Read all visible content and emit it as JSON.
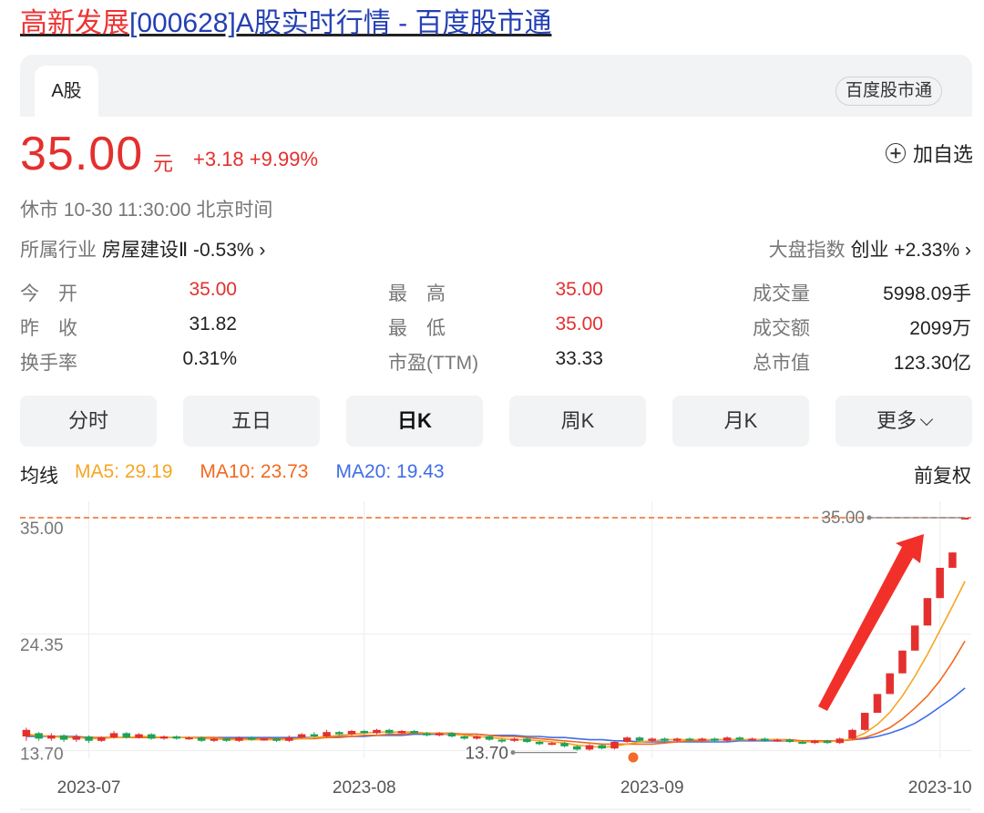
{
  "page_title": {
    "highlight": "高新发展",
    "rest": "[000628]A股实时行情 - 百度股市通"
  },
  "tabs": {
    "a_share": "A股",
    "brand": "百度股市通"
  },
  "quote": {
    "price": "35.00",
    "unit": "元",
    "change": "+3.18 +9.99%",
    "add_watchlist": "加自选",
    "status": "休市  10-30 11:30:00  北京时间",
    "industry_label": "所属行业",
    "industry_value": "房屋建设Ⅱ -0.53% ›",
    "index_label": "大盘指数",
    "index_value": "创业 +2.33% ›"
  },
  "stats": {
    "open_label": "今　开",
    "open": "35.00",
    "high_label": "最　高",
    "high": "35.00",
    "volume_label": "成交量",
    "volume": "5998.09手",
    "prev_label": "昨　收",
    "prev": "31.82",
    "low_label": "最　低",
    "low": "35.00",
    "amount_label": "成交额",
    "amount": "2099万",
    "turnover_label": "换手率",
    "turnover": "0.31%",
    "pe_label": "市盈(TTM)",
    "pe": "33.33",
    "mktcap_label": "总市值",
    "mktcap": "123.30亿"
  },
  "periods": [
    "分时",
    "五日",
    "日K",
    "周K",
    "月K",
    "更多"
  ],
  "active_period": "日K",
  "ma": {
    "label": "均线",
    "ma5": "MA5: 29.19",
    "ma10": "MA10: 23.73",
    "ma20": "MA20: 19.43",
    "adjust": "前复权"
  },
  "colors": {
    "up": "#e3302f",
    "down": "#1ea35a",
    "ma5": "#f5a623",
    "ma10": "#f2691e",
    "ma20": "#3f6de8",
    "link": "#2440b3"
  },
  "chart_data": {
    "type": "candlestick",
    "ylim": [
      13.0,
      36.5
    ],
    "y_ticks": [
      "35.00",
      "24.35",
      "13.70"
    ],
    "x_ticks": [
      "2023-07",
      "2023-08",
      "2023-09",
      "2023-10"
    ],
    "x_tick_index": [
      5,
      27,
      50,
      73
    ],
    "max_label": "35.00",
    "min_label": "13.70",
    "last_close": 35.0,
    "candles": [
      [
        15.0,
        15.6,
        14.6,
        15.8,
        "u"
      ],
      [
        15.3,
        14.8,
        14.6,
        15.4,
        "d"
      ],
      [
        14.8,
        15.1,
        14.6,
        15.3,
        "u"
      ],
      [
        15.1,
        14.7,
        14.5,
        15.2,
        "d"
      ],
      [
        14.7,
        15.0,
        14.5,
        15.2,
        "u"
      ],
      [
        15.0,
        14.6,
        14.4,
        15.1,
        "d"
      ],
      [
        14.6,
        14.9,
        14.5,
        15.0,
        "u"
      ],
      [
        14.9,
        15.3,
        14.8,
        15.5,
        "u"
      ],
      [
        15.3,
        14.9,
        14.8,
        15.4,
        "d"
      ],
      [
        14.9,
        15.2,
        14.8,
        15.3,
        "u"
      ],
      [
        15.2,
        14.8,
        14.7,
        15.3,
        "d"
      ],
      [
        14.8,
        15.0,
        14.7,
        15.1,
        "u"
      ],
      [
        15.0,
        14.8,
        14.7,
        15.1,
        "d"
      ],
      [
        14.8,
        14.9,
        14.7,
        15.0,
        "u"
      ],
      [
        14.9,
        14.6,
        14.5,
        15.0,
        "d"
      ],
      [
        14.6,
        14.8,
        14.5,
        14.9,
        "u"
      ],
      [
        14.8,
        14.6,
        14.5,
        14.9,
        "d"
      ],
      [
        14.6,
        14.9,
        14.5,
        15.0,
        "u"
      ],
      [
        14.9,
        14.7,
        14.6,
        15.0,
        "d"
      ],
      [
        14.7,
        14.8,
        14.6,
        14.9,
        "u"
      ],
      [
        14.8,
        14.6,
        14.5,
        14.9,
        "d"
      ],
      [
        14.6,
        14.9,
        14.5,
        15.1,
        "u"
      ],
      [
        14.9,
        15.2,
        14.8,
        15.3,
        "u"
      ],
      [
        15.2,
        15.0,
        14.9,
        15.4,
        "d"
      ],
      [
        15.0,
        15.4,
        14.9,
        15.6,
        "u"
      ],
      [
        15.4,
        15.2,
        15.1,
        15.5,
        "d"
      ],
      [
        15.2,
        15.5,
        15.1,
        15.6,
        "u"
      ],
      [
        15.5,
        15.3,
        15.2,
        15.6,
        "d"
      ],
      [
        15.3,
        15.6,
        15.2,
        15.7,
        "u"
      ],
      [
        15.6,
        15.3,
        15.2,
        15.7,
        "d"
      ],
      [
        15.3,
        15.5,
        15.2,
        15.6,
        "u"
      ],
      [
        15.5,
        15.3,
        15.2,
        15.6,
        "d"
      ],
      [
        15.3,
        15.1,
        15.0,
        15.4,
        "d"
      ],
      [
        15.1,
        15.3,
        15.0,
        15.4,
        "u"
      ],
      [
        15.3,
        15.0,
        14.9,
        15.4,
        "d"
      ],
      [
        15.0,
        14.8,
        14.7,
        15.1,
        "d"
      ],
      [
        14.8,
        15.0,
        14.7,
        15.1,
        "u"
      ],
      [
        15.0,
        14.7,
        14.6,
        15.1,
        "d"
      ],
      [
        14.7,
        14.6,
        14.4,
        14.8,
        "d"
      ],
      [
        14.6,
        14.8,
        14.5,
        14.9,
        "u"
      ],
      [
        14.8,
        14.5,
        14.4,
        14.9,
        "d"
      ],
      [
        14.5,
        14.3,
        14.2,
        14.6,
        "d"
      ],
      [
        14.3,
        14.4,
        14.2,
        14.5,
        "u"
      ],
      [
        14.4,
        14.1,
        14.0,
        14.5,
        "d"
      ],
      [
        14.1,
        13.8,
        13.7,
        14.2,
        "d"
      ],
      [
        13.8,
        14.2,
        13.7,
        14.3,
        "u"
      ],
      [
        14.2,
        13.9,
        13.8,
        14.3,
        "d"
      ],
      [
        13.9,
        14.5,
        13.8,
        14.6,
        "u"
      ],
      [
        14.5,
        14.9,
        14.4,
        15.0,
        "u"
      ],
      [
        14.9,
        14.6,
        14.5,
        15.0,
        "d"
      ],
      [
        14.6,
        14.8,
        14.5,
        14.9,
        "u"
      ],
      [
        14.8,
        14.6,
        14.5,
        14.9,
        "d"
      ],
      [
        14.6,
        14.8,
        14.5,
        14.9,
        "u"
      ],
      [
        14.8,
        14.7,
        14.6,
        14.9,
        "d"
      ],
      [
        14.7,
        14.8,
        14.6,
        14.9,
        "u"
      ],
      [
        14.8,
        14.6,
        14.5,
        14.9,
        "d"
      ],
      [
        14.6,
        14.9,
        14.5,
        15.0,
        "u"
      ],
      [
        14.9,
        14.7,
        14.6,
        15.0,
        "d"
      ],
      [
        14.7,
        14.8,
        14.6,
        14.9,
        "u"
      ],
      [
        14.8,
        14.6,
        14.5,
        14.9,
        "d"
      ],
      [
        14.6,
        14.7,
        14.5,
        14.8,
        "u"
      ],
      [
        14.7,
        14.5,
        14.4,
        14.8,
        "d"
      ],
      [
        14.5,
        14.4,
        14.3,
        14.6,
        "d"
      ],
      [
        14.4,
        14.6,
        14.3,
        14.7,
        "u"
      ],
      [
        14.6,
        14.4,
        14.3,
        14.7,
        "d"
      ],
      [
        14.4,
        14.8,
        14.3,
        14.9,
        "u"
      ],
      [
        14.8,
        15.6,
        14.7,
        15.7,
        "u"
      ],
      [
        15.6,
        17.16,
        15.5,
        17.16,
        "u"
      ],
      [
        17.16,
        18.88,
        17.16,
        18.88,
        "u"
      ],
      [
        18.88,
        20.77,
        18.88,
        20.77,
        "u"
      ],
      [
        20.77,
        22.85,
        20.77,
        22.85,
        "u"
      ],
      [
        22.85,
        25.14,
        22.85,
        25.14,
        "u"
      ],
      [
        25.14,
        27.65,
        25.14,
        27.65,
        "u"
      ],
      [
        27.65,
        30.42,
        27.65,
        30.42,
        "u"
      ],
      [
        30.42,
        31.82,
        30.42,
        31.82,
        "u"
      ],
      [
        35.0,
        35.0,
        35.0,
        35.0,
        "u"
      ]
    ],
    "ma5_values": [
      15.2,
      15.1,
      15.0,
      14.9,
      14.9,
      14.8,
      14.8,
      14.9,
      14.9,
      15.0,
      15.0,
      14.9,
      14.9,
      14.9,
      14.8,
      14.8,
      14.7,
      14.7,
      14.7,
      14.7,
      14.7,
      14.7,
      14.8,
      14.9,
      15.0,
      15.1,
      15.2,
      15.3,
      15.4,
      15.4,
      15.4,
      15.4,
      15.3,
      15.3,
      15.2,
      15.1,
      15.0,
      14.9,
      14.8,
      14.7,
      14.7,
      14.6,
      14.5,
      14.4,
      14.2,
      14.1,
      14.0,
      14.1,
      14.3,
      14.5,
      14.6,
      14.7,
      14.7,
      14.7,
      14.7,
      14.7,
      14.7,
      14.7,
      14.7,
      14.7,
      14.7,
      14.6,
      14.5,
      14.5,
      14.5,
      14.6,
      14.8,
      15.3,
      16.1,
      17.2,
      18.7,
      20.5,
      22.5,
      24.7,
      26.9,
      29.19
    ],
    "ma10_values": [
      15.1,
      15.1,
      15.0,
      15.0,
      14.9,
      14.9,
      14.9,
      14.9,
      14.9,
      14.9,
      14.9,
      14.9,
      14.9,
      14.9,
      14.9,
      14.9,
      14.8,
      14.8,
      14.8,
      14.8,
      14.8,
      14.8,
      14.8,
      14.8,
      14.9,
      14.9,
      15.0,
      15.1,
      15.1,
      15.2,
      15.2,
      15.3,
      15.3,
      15.3,
      15.3,
      15.2,
      15.2,
      15.1,
      15.0,
      15.0,
      14.9,
      14.8,
      14.7,
      14.6,
      14.5,
      14.4,
      14.3,
      14.3,
      14.3,
      14.3,
      14.3,
      14.4,
      14.5,
      14.6,
      14.6,
      14.7,
      14.7,
      14.7,
      14.7,
      14.7,
      14.7,
      14.7,
      14.6,
      14.6,
      14.6,
      14.6,
      14.7,
      14.9,
      15.3,
      15.8,
      16.6,
      17.6,
      18.7,
      20.1,
      21.8,
      23.73
    ],
    "ma20_values": [
      15.0,
      15.0,
      15.0,
      15.0,
      15.0,
      14.9,
      14.9,
      14.9,
      14.9,
      14.9,
      14.9,
      14.9,
      14.9,
      14.9,
      14.9,
      14.9,
      14.9,
      14.9,
      14.9,
      14.9,
      14.9,
      14.9,
      14.9,
      14.9,
      14.9,
      15.0,
      15.0,
      15.0,
      15.1,
      15.1,
      15.1,
      15.2,
      15.2,
      15.2,
      15.2,
      15.2,
      15.2,
      15.1,
      15.1,
      15.1,
      15.0,
      15.0,
      14.9,
      14.9,
      14.8,
      14.7,
      14.7,
      14.6,
      14.6,
      14.5,
      14.5,
      14.5,
      14.5,
      14.5,
      14.5,
      14.5,
      14.5,
      14.6,
      14.6,
      14.6,
      14.6,
      14.6,
      14.6,
      14.6,
      14.6,
      14.6,
      14.7,
      14.8,
      15.0,
      15.3,
      15.7,
      16.2,
      16.9,
      17.7,
      18.5,
      19.43
    ]
  }
}
